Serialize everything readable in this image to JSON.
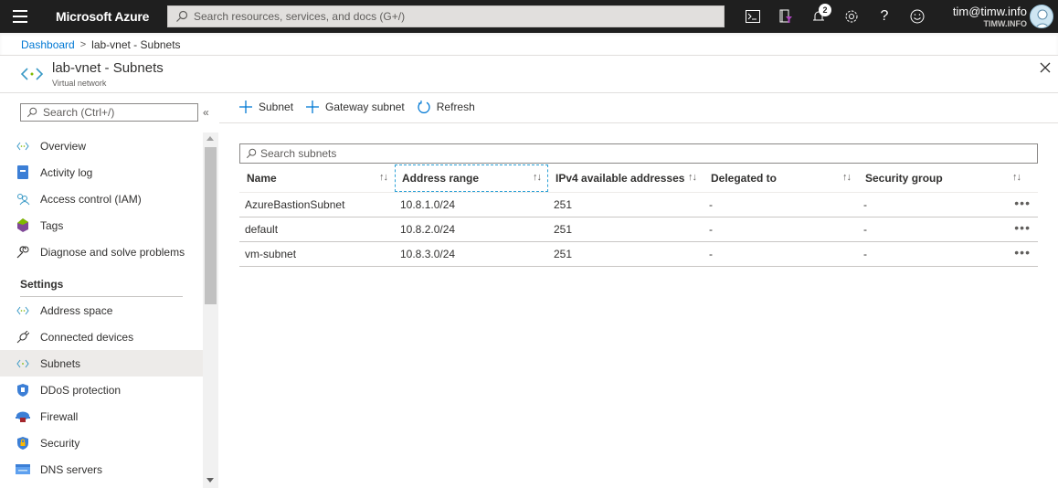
{
  "topbar": {
    "brand": "Microsoft Azure",
    "search_placeholder": "Search resources, services, and docs (G+/)",
    "notification_count": "2",
    "user_name": "tim@timw.info",
    "user_directory": "TIMW.INFO",
    "icons": [
      "cloud-shell-icon",
      "directory-filter-icon",
      "notifications-icon",
      "settings-icon",
      "help-icon",
      "feedback-icon"
    ]
  },
  "breadcrumb": {
    "items": [
      "Dashboard",
      "lab-vnet - Subnets"
    ]
  },
  "blade": {
    "title": "lab-vnet - Subnets",
    "subtitle": "Virtual network"
  },
  "menu": {
    "search_placeholder": "Search (Ctrl+/)",
    "items": [
      {
        "label": "Overview",
        "icon": "vnet-icon"
      },
      {
        "label": "Activity log",
        "icon": "activity-log-icon"
      },
      {
        "label": "Access control (IAM)",
        "icon": "iam-icon"
      },
      {
        "label": "Tags",
        "icon": "tag-icon"
      },
      {
        "label": "Diagnose and solve problems",
        "icon": "wrench-icon"
      }
    ],
    "section": "Settings",
    "settings_items": [
      {
        "label": "Address space",
        "icon": "vnet-icon"
      },
      {
        "label": "Connected devices",
        "icon": "plug-icon"
      },
      {
        "label": "Subnets",
        "icon": "vnet-icon",
        "active": true
      },
      {
        "label": "DDoS protection",
        "icon": "shield-icon"
      },
      {
        "label": "Firewall",
        "icon": "firewall-icon"
      },
      {
        "label": "Security",
        "icon": "security-icon"
      },
      {
        "label": "DNS servers",
        "icon": "dns-icon"
      }
    ]
  },
  "toolbar": {
    "add_subnet": "Subnet",
    "add_gateway_subnet": "Gateway subnet",
    "refresh": "Refresh"
  },
  "grid": {
    "search_placeholder": "Search subnets",
    "columns": [
      "Name",
      "Address range",
      "IPv4 available addresses",
      "Delegated to",
      "Security group"
    ],
    "rows": [
      {
        "name": "AzureBastionSubnet",
        "address_range": "10.8.1.0/24",
        "ipv4_available": "251",
        "delegated_to": "-",
        "security_group": "-"
      },
      {
        "name": "default",
        "address_range": "10.8.2.0/24",
        "ipv4_available": "251",
        "delegated_to": "-",
        "security_group": "-"
      },
      {
        "name": "vm-subnet",
        "address_range": "10.8.3.0/24",
        "ipv4_available": "251",
        "delegated_to": "-",
        "security_group": "-"
      }
    ],
    "sort_glyph": "↑↓",
    "more_glyph": "•••"
  },
  "colors": {
    "accent": "#0078d4",
    "topbar_bg": "#1f1f1f",
    "focus_outline": "#2aa0d6"
  }
}
